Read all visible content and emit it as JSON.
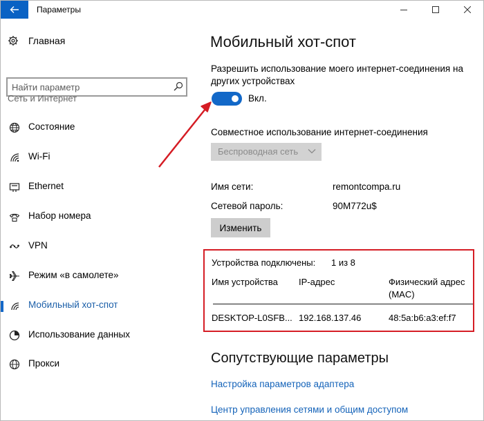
{
  "window": {
    "title": "Параметры"
  },
  "sidebar": {
    "home_label": "Главная",
    "search_placeholder": "Найти параметр",
    "section_label": "Сеть и Интернет",
    "items": [
      {
        "label": "Состояние",
        "icon": "globe-icon"
      },
      {
        "label": "Wi-Fi",
        "icon": "wifi-icon"
      },
      {
        "label": "Ethernet",
        "icon": "ethernet-icon"
      },
      {
        "label": "Набор номера",
        "icon": "dialup-icon"
      },
      {
        "label": "VPN",
        "icon": "vpn-icon"
      },
      {
        "label": "Режим «в самолете»",
        "icon": "airplane-icon"
      },
      {
        "label": "Мобильный хот-спот",
        "icon": "hotspot-icon",
        "active": true
      },
      {
        "label": "Использование данных",
        "icon": "data-usage-icon"
      },
      {
        "label": "Прокси",
        "icon": "proxy-globe-icon"
      }
    ]
  },
  "main": {
    "title": "Мобильный хот-спот",
    "share_desc_line1": "Разрешить использование моего интернет-соединения на",
    "share_desc_line2": "других устройствах",
    "toggle_state_label": "Вкл.",
    "toggle_on": true,
    "share_from_label": "Совместное использование интернет-соединения",
    "share_from_value": "Беспроводная сеть",
    "network_name_label": "Имя сети:",
    "network_name_value": "remontcompa.ru",
    "password_label": "Сетевой пароль:",
    "password_value": "90M772u$",
    "edit_button": "Изменить",
    "devices": {
      "connected_label": "Устройства подключены:",
      "connected_value": "1 из 8",
      "columns": [
        "Имя устройства",
        "IP-адрес",
        "Физический адрес",
        "(MAC)"
      ],
      "rows": [
        {
          "name": "DESKTOP-L0SFB...",
          "ip": "192.168.137.46",
          "mac": "48:5a:b6:a3:ef:f7"
        }
      ]
    },
    "related_title": "Сопутствующие параметры",
    "links": [
      "Настройка параметров адаптера",
      "Центр управления сетями и общим доступом"
    ]
  },
  "colors": {
    "accent": "#1268c8",
    "highlight_frame": "#d51c24",
    "link": "#1463b9"
  }
}
